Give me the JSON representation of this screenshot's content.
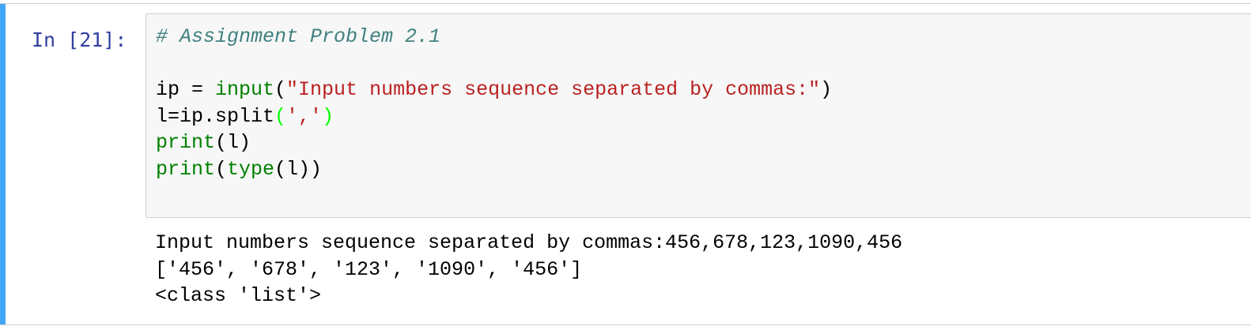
{
  "cell": {
    "prompt": "In [21]:",
    "code": {
      "comment": "# Assignment Problem 2.1",
      "line2_var": "ip = ",
      "line2_func": "input",
      "line2_open": "(",
      "line2_string": "\"Input numbers sequence separated by commas:\"",
      "line2_close": ")",
      "line3_prefix": "l=ip.split",
      "line3_open": "(",
      "line3_string": "','",
      "line3_close": ")",
      "line4_func": "print",
      "line4_rest": "(l)",
      "line5_func": "print",
      "line5_open": "(",
      "line5_func2": "type",
      "line5_rest": "(l))"
    },
    "output": {
      "line1": "Input numbers sequence separated by commas:456,678,123,1090,456",
      "line2": "['456', '678', '123', '1090', '456']",
      "line3": "<class 'list'>"
    }
  },
  "colors": {
    "selected_cell_bar": "#42a5f5",
    "prompt": "#303f9f",
    "comment": "#408080",
    "builtin": "#008000",
    "string": "#ba2121",
    "input_background": "#f7f7f7"
  }
}
